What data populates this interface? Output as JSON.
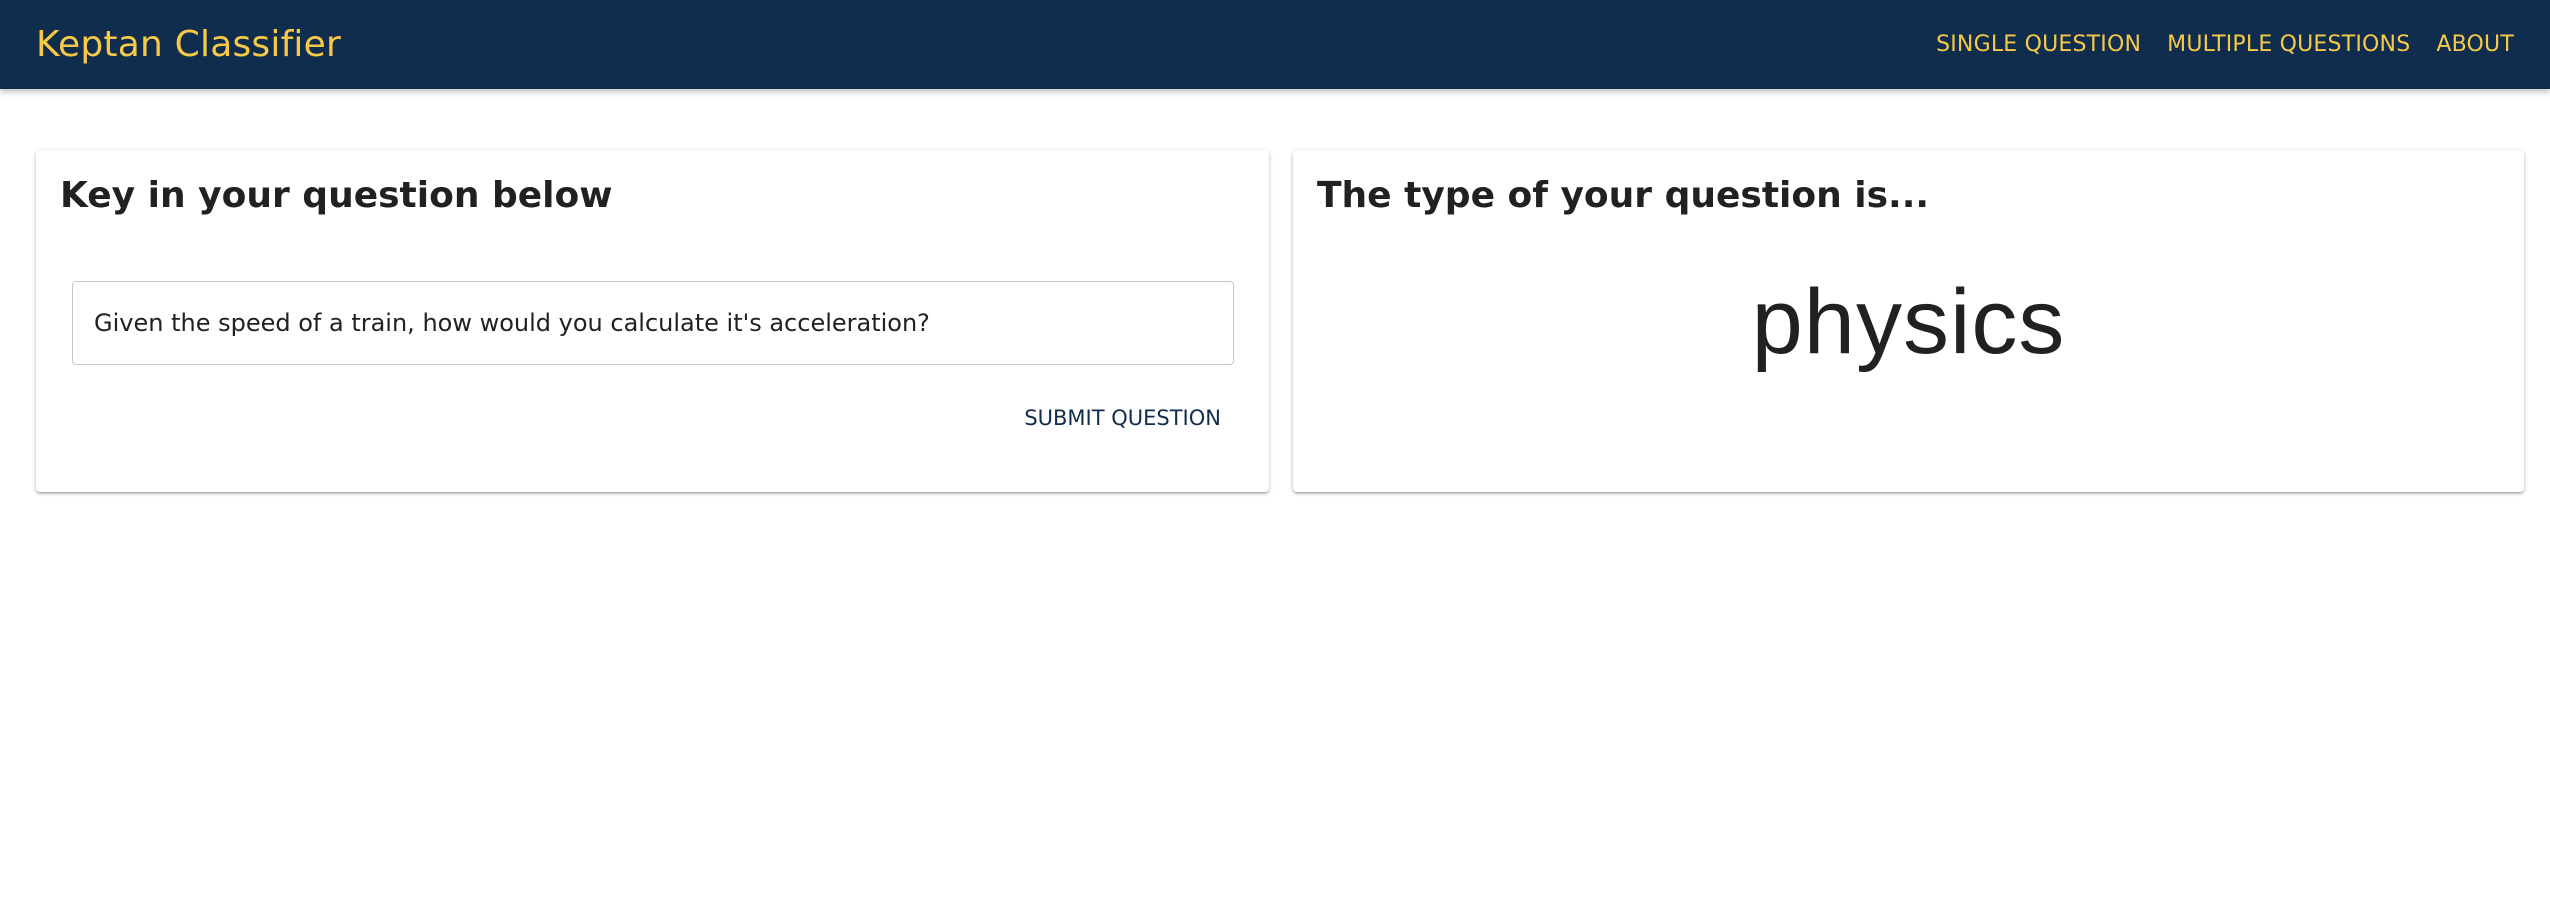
{
  "app": {
    "title": "Keptan Classifier"
  },
  "nav": {
    "items": [
      {
        "label": "SINGLE QUESTION"
      },
      {
        "label": "MULTIPLE QUESTIONS"
      },
      {
        "label": "ABOUT"
      }
    ]
  },
  "question_card": {
    "title": "Key in your question below",
    "input_value": "Given the speed of a train, how would you calculate it's acceleration?",
    "submit_label": "SUBMIT QUESTION"
  },
  "result_card": {
    "title": "The type of your question is...",
    "result": "physics"
  },
  "colors": {
    "navbar_bg": "#112d4e",
    "accent": "#f7c948",
    "text": "#212121"
  }
}
